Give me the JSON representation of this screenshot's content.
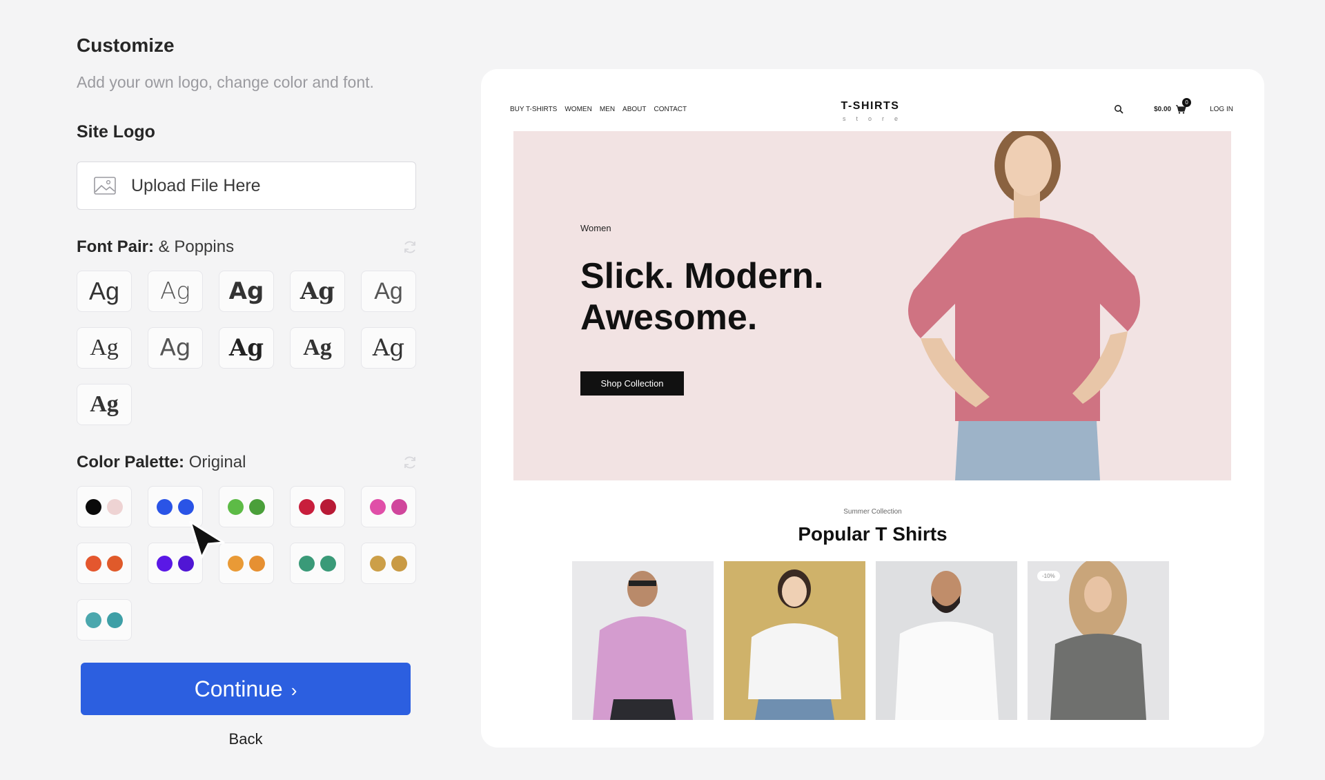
{
  "customize": {
    "title": "Customize",
    "subtitle": "Add your own logo, change color and font.",
    "site_logo": {
      "label": "Site Logo",
      "upload_label": "Upload File Here",
      "icon": "image-icon"
    },
    "font_pair": {
      "label": "Font Pair:",
      "value": "& Poppins",
      "sample": "Ag",
      "count": 11
    },
    "color_palette": {
      "label": "Color Palette:",
      "value": "Original",
      "palettes": [
        [
          "#0a0a0a",
          "#eed3d3"
        ],
        [
          "#2a54e6",
          "#2a54e6"
        ],
        [
          "#5dbb46",
          "#4a9f3a"
        ],
        [
          "#c81e3c",
          "#b81a36"
        ],
        [
          "#e04fa8",
          "#d0469c"
        ],
        [
          "#e4572e",
          "#e05a2a"
        ],
        [
          "#5a18e6",
          "#5016d4"
        ],
        [
          "#e99a36",
          "#e69032"
        ],
        [
          "#3a9a78",
          "#3a9a78"
        ],
        [
          "#cc9f48",
          "#c99a44"
        ],
        [
          "#4ba7ad",
          "#3e9fa6"
        ]
      ]
    },
    "continue_label": "Continue",
    "back_label": "Back",
    "accent_color": "#2c5fe0"
  },
  "preview": {
    "nav": {
      "links": [
        "BUY T-SHIRTS",
        "WOMEN",
        "MEN",
        "ABOUT",
        "CONTACT"
      ],
      "brand": "T-SHIRTS",
      "brand_sub": "store",
      "price": "$0.00",
      "cart_count": "0",
      "login": "LOG IN"
    },
    "hero": {
      "kicker": "Women",
      "headline_line1": "Slick. Modern.",
      "headline_line2": "Awesome.",
      "cta": "Shop Collection"
    },
    "section": {
      "kicker": "Summer Collection",
      "title": "Popular T Shirts"
    },
    "products": [
      {
        "name": "man-pink-tshirt",
        "badge": ""
      },
      {
        "name": "woman-white-tshirt",
        "badge": ""
      },
      {
        "name": "man-white-tshirt",
        "badge": ""
      },
      {
        "name": "woman-grey-tshirt",
        "badge": "-10%"
      }
    ]
  }
}
